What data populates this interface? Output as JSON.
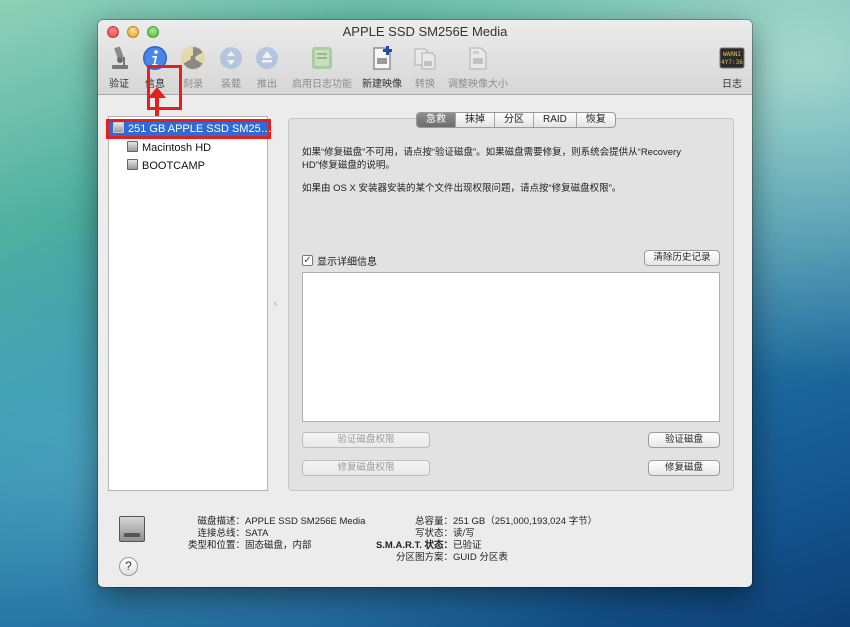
{
  "window": {
    "title": "APPLE SSD SM256E Media"
  },
  "toolbar": {
    "verify": "验证",
    "info": "信息",
    "burn": "刻录",
    "mount": "装载",
    "eject": "推出",
    "enable_journaling": "启用日志功能",
    "new_image": "新建映像",
    "convert": "转换",
    "resize_image": "调整映像大小",
    "log": "日志",
    "log_icon_text_top": "WARNI",
    "log_icon_text_bottom": "4Y7:36"
  },
  "sidebar": {
    "items": [
      {
        "label": "251 GB APPLE SSD SM25…",
        "selected": true
      },
      {
        "label": "Macintosh HD"
      },
      {
        "label": "BOOTCAMP"
      }
    ]
  },
  "tabs": [
    {
      "label": "急救",
      "active": true
    },
    {
      "label": "抹掉"
    },
    {
      "label": "分区"
    },
    {
      "label": "RAID"
    },
    {
      "label": "恢复"
    }
  ],
  "firstaid": {
    "para1_line1": "如果“修复磁盘”不可用，请点按“验证磁盘”。如果磁盘需要修复，则系统会提供从“Recovery",
    "para1_line2": "HD”修复磁盘的说明。",
    "para2": "如果由 OS X 安装器安装的某个文件出现权限问题，请点按“修复磁盘权限”。",
    "show_details": "显示详细信息",
    "show_details_checked": true,
    "clear_history": "清除历史记录",
    "verify_permissions": "验证磁盘权限",
    "repair_permissions": "修复磁盘权限",
    "verify_disk": "验证磁盘",
    "repair_disk": "修复磁盘"
  },
  "info": {
    "left": [
      {
        "key": "磁盘描述：",
        "value": "APPLE SSD SM256E Media"
      },
      {
        "key": "连接总线：",
        "value": "SATA"
      },
      {
        "key": "类型和位置：",
        "value": "固态磁盘，内部"
      }
    ],
    "right": [
      {
        "key": "总容量：",
        "value": "251 GB（251,000,193,024 字节）"
      },
      {
        "key": "写状态：",
        "value": "读/写"
      },
      {
        "key": "S.M.A.R.T. 状态：",
        "value": "已验证"
      },
      {
        "key": "分区图方案：",
        "value": "GUID 分区表"
      }
    ]
  },
  "help": {
    "label": "?"
  },
  "colors": {
    "selection": "#2f6bd7",
    "annotation": "#e4201e",
    "info_icon": "#2b63c9"
  }
}
